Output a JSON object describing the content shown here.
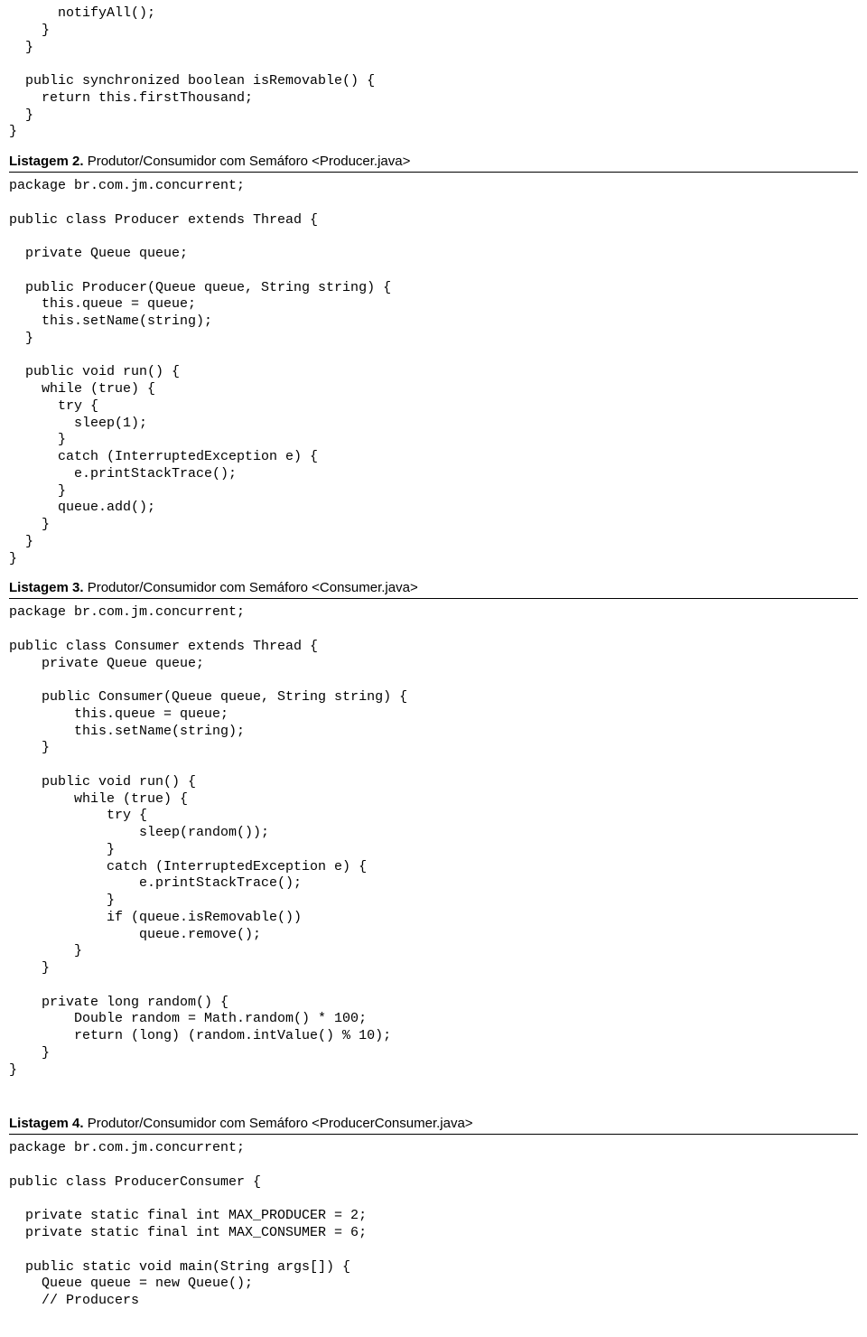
{
  "codeBlock1": "      notifyAll();\n    }\n  }\n\n  public synchronized boolean isRemovable() {\n    return this.firstThousand;\n  }\n}",
  "listing2": {
    "prefix": "Listagem 2.",
    "title": " Produtor/Consumidor com Semáforo <Producer.java>"
  },
  "codeBlock2": "package br.com.jm.concurrent;\n\npublic class Producer extends Thread {\n\n  private Queue queue;\n\n  public Producer(Queue queue, String string) {\n    this.queue = queue;\n    this.setName(string);\n  }\n\n  public void run() {\n    while (true) {\n      try {\n        sleep(1);\n      }\n      catch (InterruptedException e) {\n        e.printStackTrace();\n      }\n      queue.add();\n    }\n  }\n}",
  "listing3": {
    "prefix": "Listagem 3.",
    "title": " Produtor/Consumidor com Semáforo <Consumer.java>"
  },
  "codeBlock3": "package br.com.jm.concurrent;\n\npublic class Consumer extends Thread {\n    private Queue queue;\n\n    public Consumer(Queue queue, String string) {\n        this.queue = queue;\n        this.setName(string);\n    }\n\n    public void run() {\n        while (true) {\n            try {\n                sleep(random());\n            }\n            catch (InterruptedException e) {\n                e.printStackTrace();\n            }\n            if (queue.isRemovable())\n                queue.remove();\n        }\n    }\n\n    private long random() {\n        Double random = Math.random() * 100;\n        return (long) (random.intValue() % 10);\n    }\n}",
  "listing4": {
    "prefix": "Listagem 4.",
    "title": " Produtor/Consumidor com Semáforo <ProducerConsumer.java>"
  },
  "codeBlock4": "package br.com.jm.concurrent;\n\npublic class ProducerConsumer {\n\n  private static final int MAX_PRODUCER = 2;\n  private static final int MAX_CONSUMER = 6;\n\n  public static void main(String args[]) {\n    Queue queue = new Queue();\n    // Producers"
}
